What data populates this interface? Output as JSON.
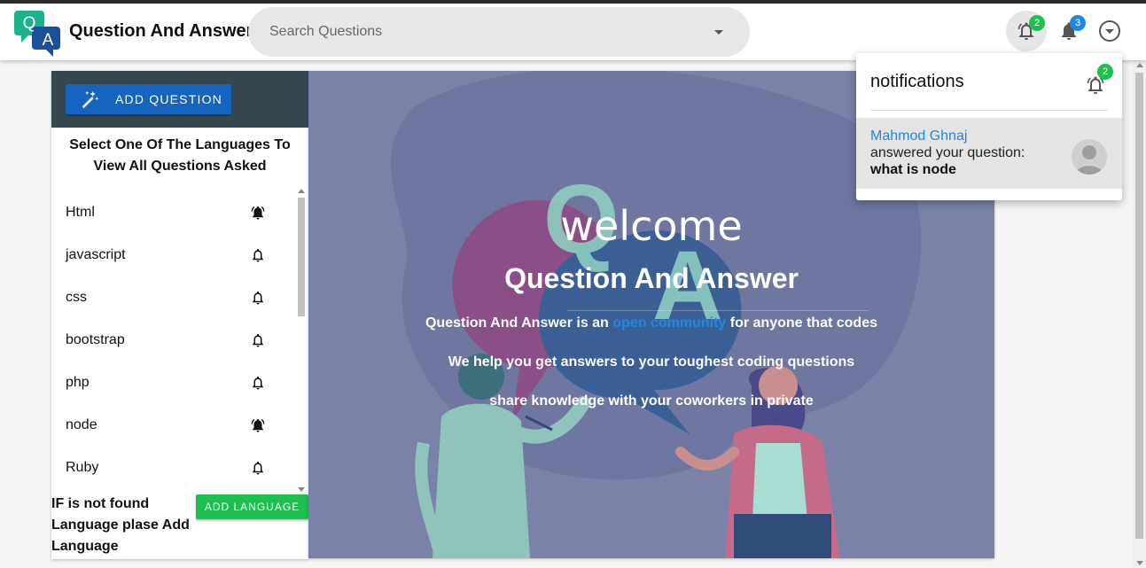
{
  "header": {
    "brand_letters": [
      "Q",
      "A"
    ],
    "title": "Question And Answer",
    "search_placeholder": "Search Questions",
    "notifications_badge": "2",
    "alerts_badge": "3"
  },
  "sidebar": {
    "add_question_label": "ADD QUESTION",
    "select_title": "Select One Of The Languages To View All Questions Asked",
    "languages": [
      {
        "label": "Html",
        "subscribed": true
      },
      {
        "label": "javascript",
        "subscribed": false
      },
      {
        "label": "css",
        "subscribed": false
      },
      {
        "label": "bootstrap",
        "subscribed": false
      },
      {
        "label": "php",
        "subscribed": false
      },
      {
        "label": "node",
        "subscribed": true
      },
      {
        "label": "Ruby",
        "subscribed": false
      }
    ],
    "not_found_text": "IF is not found Language plase Add Language",
    "add_language_label": "ADD LANGUAGE"
  },
  "hero": {
    "welcome": "welcome",
    "title": "Question And Answer",
    "line1_pre": "Question And Answer is an ",
    "line1_link": "open community",
    "line1_post": " for anyone that codes",
    "line2": "We help you get answers to your toughest coding questions",
    "line3": "share knowledge with your coworkers in private",
    "art_letters": [
      "Q",
      "A"
    ]
  },
  "notifications_panel": {
    "title": "notifications",
    "badge": "2",
    "items": [
      {
        "user": "Mahmod Ghnaj",
        "action": "answered your question:",
        "question": "what is node"
      }
    ]
  },
  "colors": {
    "primary_blue": "#1565c0",
    "success_green": "#1ebf4e",
    "link_blue": "#1e88e5",
    "sidebar_header": "#37474f",
    "hero_overlay": "#7a82a8"
  },
  "icons": {
    "logo": "qa-speech-bubbles-logo",
    "add_question": "magic-wand-icon",
    "bell_outline": "bell-outline-icon",
    "bell_filled": "bell-ring-icon",
    "account_menu": "chevron-circle-down-icon"
  }
}
